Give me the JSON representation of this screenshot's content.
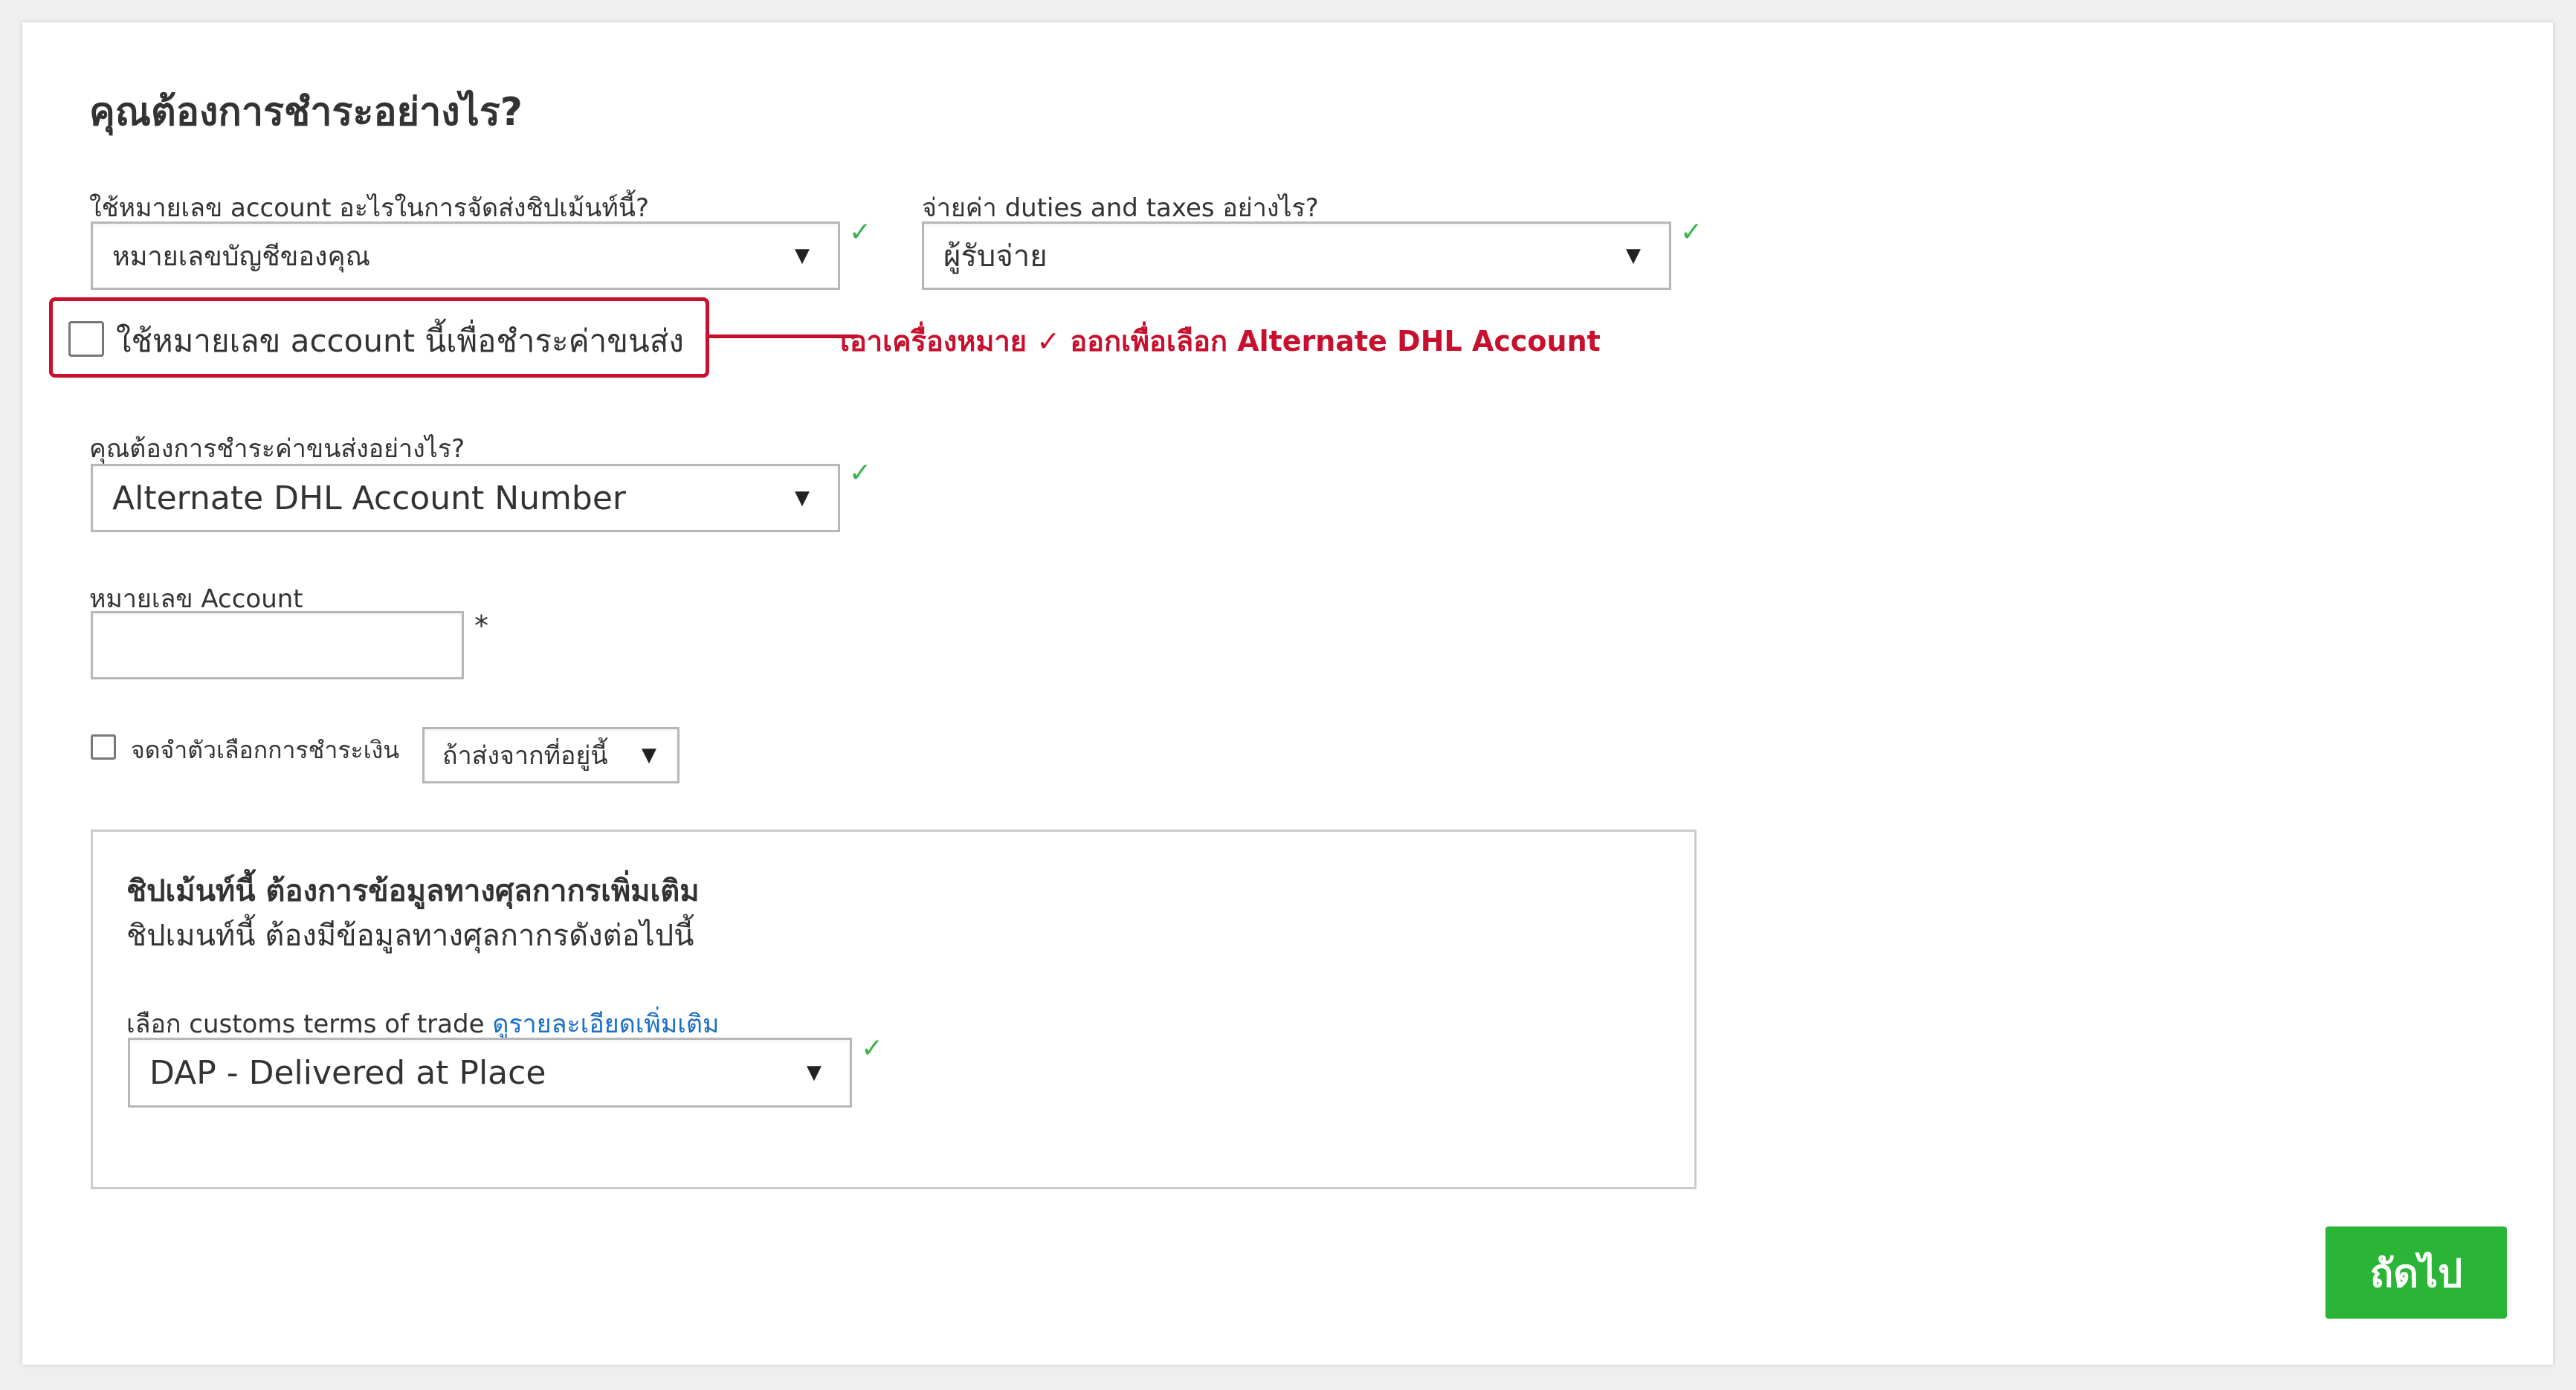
{
  "page": {
    "title": "คุณต้องการชำระอย่างไร?"
  },
  "account_usage": {
    "label": "ใช้หมายเลข account อะไรในการจัดส่งชิปเม้นท์นี้?",
    "selected": "หมายเลขบัญชีของคุณ",
    "valid_icon": "checkmark-icon"
  },
  "duties_taxes": {
    "label": "จ่ายค่า duties and taxes อย่างไร?",
    "selected": "ผู้รับจ่าย",
    "valid_icon": "checkmark-icon"
  },
  "use_account_for_shipping": {
    "label": "ใช้หมายเลข account นี้เพื่อชำระค่าขนส่ง",
    "checked": false
  },
  "annotation": {
    "text": "เอาเครื่องหมาย ✓   ออกเพื่อเลือก Alternate DHL Account",
    "color": "#c8102e"
  },
  "shipping_payment": {
    "label": "คุณต้องการชำระค่าขนส่งอย่างไร?",
    "selected": "Alternate DHL Account Number",
    "valid_icon": "checkmark-icon"
  },
  "account_number": {
    "label": "หมายเลข Account",
    "value": "",
    "required_mark": "*"
  },
  "remember_payment": {
    "label": "จดจำตัวเลือกการชำระเงิน",
    "checked": false,
    "dropdown_selected": "ถ้าส่งจากที่อยู่นี้"
  },
  "customs": {
    "heading": "ชิปเม้นท์นี้ ต้องการข้อมูลทางศุลกากรเพิ่มเติม",
    "subheading": "ชิปเมนท์นี้ ต้องมีข้อมูลทางศุลกากรดังต่อไปนี้",
    "terms_label": "เลือก customs terms of trade",
    "details_link": "ดูรายละเอียดเพิ่มเติม",
    "selected": "DAP - Delivered at Place",
    "valid_icon": "checkmark-icon"
  },
  "next_button": {
    "label": "ถัดไป",
    "color": "#2ab536"
  },
  "glyphs": {
    "dropdown_arrow": "▼",
    "valid_check": "✓"
  }
}
